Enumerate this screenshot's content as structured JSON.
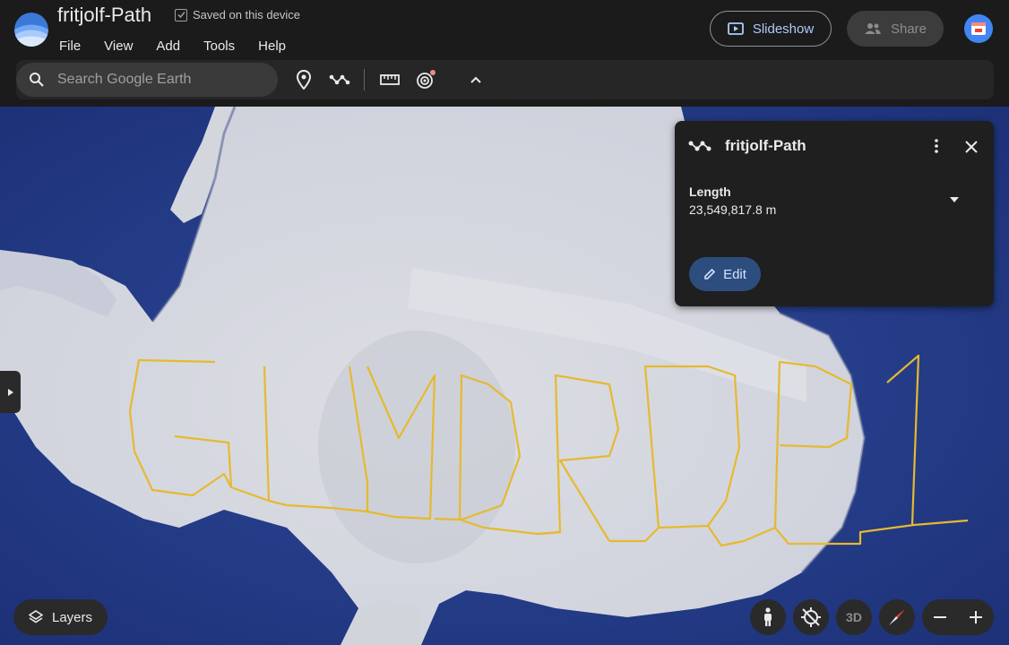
{
  "app": {
    "title": "fritjolf-Path",
    "saved_status": "Saved on this device"
  },
  "menu": [
    "File",
    "View",
    "Add",
    "Tools",
    "Help"
  ],
  "header_buttons": {
    "slideshow": "Slideshow",
    "share": "Share"
  },
  "search": {
    "placeholder": "Search Google Earth"
  },
  "toolbar_icons": [
    "place-marker-icon",
    "path-icon",
    "ruler-icon",
    "orbit-icon",
    "chevron-up-icon"
  ],
  "panel": {
    "title": "fritjolf-Path",
    "field_label": "Length",
    "field_value": "23,549,817.8 m",
    "edit_label": "Edit"
  },
  "bottom": {
    "layers_label": "Layers",
    "view_3d_label": "3D"
  },
  "colors": {
    "accent": "#aecbfa",
    "path": "#e6b92f",
    "ocean": "#233d8a",
    "ice": "#d7d9e0"
  }
}
